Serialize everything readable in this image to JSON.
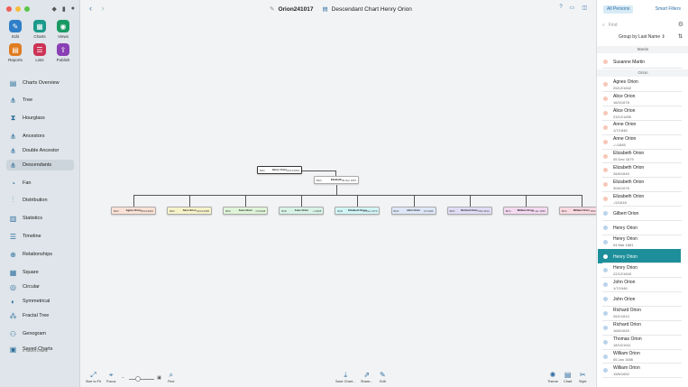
{
  "toolbar_left": {
    "back": "‹",
    "forward": "›"
  },
  "window_title": {
    "file_name": "Orion241017",
    "chart_title": "Descendant Chart Henry Orion"
  },
  "sidebar": {
    "tiles": [
      {
        "label": "Edit",
        "icon": "edit-icon",
        "color": "#2f7fc8",
        "glyph": "✎"
      },
      {
        "label": "Charts",
        "icon": "charts-icon",
        "color": "#1a9a8a",
        "glyph": "▦"
      },
      {
        "label": "Views",
        "icon": "views-icon",
        "color": "#1a9a63",
        "glyph": "◉"
      },
      {
        "label": "Reports",
        "icon": "reports-icon",
        "color": "#e07b20",
        "glyph": "▤"
      },
      {
        "label": "Lists",
        "icon": "lists-icon",
        "color": "#cc3355",
        "glyph": "☰"
      },
      {
        "label": "Publish",
        "icon": "publish-icon",
        "color": "#8a3fb5",
        "glyph": "⇪"
      }
    ],
    "nav": [
      "Charts Overview",
      "Tree",
      "Hourglass",
      "Ancestors",
      "Double Ancestor",
      "Descendants",
      "Fan",
      "Distribution",
      "Statistics",
      "Timeline",
      "Relationships",
      "Square",
      "Circular",
      "Symmetrical",
      "Fractal Tree",
      "Genogram",
      "Saved Charts"
    ],
    "active_nav": "Descendants",
    "saved_sub": "0 Saved Charts"
  },
  "chart": {
    "root": {
      "name": "Henry Orion",
      "birth_label": "Birth",
      "birth": "22/12/1843"
    },
    "spouse": {
      "name": "Elizabeth",
      "birth_label": "Birth",
      "birth": "05 Dec 1876"
    },
    "children": [
      {
        "name": "Agnes Orion",
        "birth": "25/12/1842",
        "color": "#fbe1d5"
      },
      {
        "name": "Alice Orion",
        "birth": "23/12/1895",
        "color": "#f7f3c9"
      },
      {
        "name": "Anne Orion",
        "birth": "1/7/1848",
        "color": "#dff5d8"
      },
      {
        "name": "Anne Orion",
        "birth": "-/-/1845",
        "color": "#d7f3e6"
      },
      {
        "name": "Elizabeth Orion",
        "birth": "05 Dec 1679",
        "color": "#d2f6f7"
      },
      {
        "name": "John Orion",
        "birth": "1/7/1946",
        "color": "#dde7f8"
      },
      {
        "name": "Richard Orion",
        "birth": "26/1/1614",
        "color": "#e1dcf6"
      },
      {
        "name": "William Orion",
        "birth": "05 Jan 1656",
        "color": "#f4d9f1"
      },
      {
        "name": "William Orion",
        "birth": "15/6/1652",
        "color": "#fbd9e0"
      }
    ],
    "birth_label": "Birth"
  },
  "bottom_toolbar": {
    "size_to_fit": "Size to Fit",
    "focus": "Focus",
    "find": "Find",
    "save_chart": "Save Chart...",
    "share": "Share...",
    "edit": "Edit",
    "theme": "Theme",
    "chart": "Chart",
    "style": "Style"
  },
  "right_panel": {
    "tab_all": "All Persons",
    "tab_smart": "Smart Filters",
    "search_placeholder": "Find",
    "group_by": "Group by Last Name",
    "sections": [
      {
        "title": "Martin",
        "people": [
          {
            "name": "Susanne Martin",
            "date": "",
            "gender": "f"
          }
        ]
      },
      {
        "title": "Orion",
        "people": [
          {
            "name": "Agnes Orion",
            "date": "25/12/1842",
            "gender": "f"
          },
          {
            "name": "Alice Orion",
            "date": "16/3/1678",
            "gender": "f"
          },
          {
            "name": "Alice Orion",
            "date": "23/12/1895",
            "gender": "f"
          },
          {
            "name": "Anne Orion",
            "date": "1/7/1848",
            "gender": "f"
          },
          {
            "name": "Anne Orion",
            "date": "-/-/1845",
            "gender": "f"
          },
          {
            "name": "Elizabeth Orion",
            "date": "05 Dec 1679",
            "gender": "f"
          },
          {
            "name": "Elizabeth Orion",
            "date": "26/6/1640",
            "gender": "f"
          },
          {
            "name": "Elizabeth Orion",
            "date": "30/6/1676",
            "gender": "f"
          },
          {
            "name": "Elizabeth Orion",
            "date": "-/2/1618",
            "gender": "f"
          },
          {
            "name": "Gilbert Orion",
            "date": "",
            "gender": "m"
          },
          {
            "name": "Henry Orion",
            "date": "",
            "gender": "m"
          },
          {
            "name": "Henry Orion",
            "date": "04 Mar 1681",
            "gender": "m"
          },
          {
            "name": "Henry Orion",
            "date": "",
            "gender": "m",
            "selected": true
          },
          {
            "name": "Henry Orion",
            "date": "22/12/1843",
            "gender": "m"
          },
          {
            "name": "John Orion",
            "date": "1/7/1946",
            "gender": "m"
          },
          {
            "name": "John Orion",
            "date": "",
            "gender": "m"
          },
          {
            "name": "Richard Orion",
            "date": "26/1/1614",
            "gender": "m"
          },
          {
            "name": "Richard Orion",
            "date": "16/6/1649",
            "gender": "m"
          },
          {
            "name": "Thomas Orion",
            "date": "18/10/1611",
            "gender": "m"
          },
          {
            "name": "William Orion",
            "date": "05 Jan 1656",
            "gender": "m"
          },
          {
            "name": "William Orion",
            "date": "15/6/1652",
            "gender": "m"
          }
        ]
      }
    ],
    "colors": {
      "female": "#f6c7b8",
      "male": "#b9d3ea",
      "selected": "#1d8f9a"
    }
  }
}
